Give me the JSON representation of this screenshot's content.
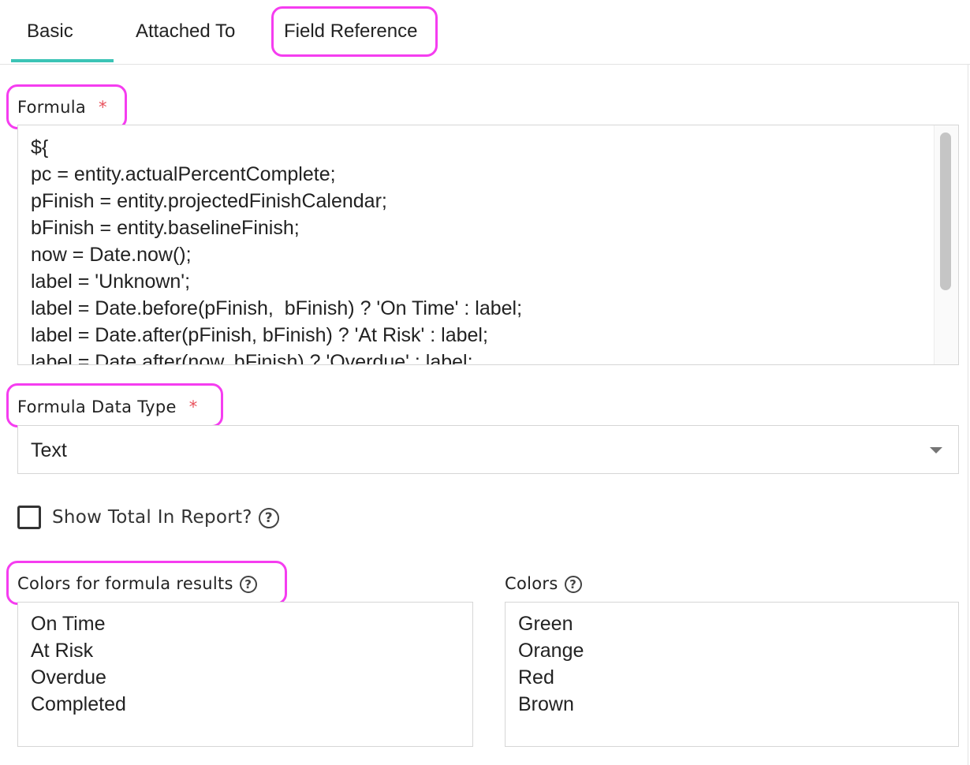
{
  "tabs": [
    {
      "label": "Basic",
      "active": true
    },
    {
      "label": "Attached To",
      "active": false
    },
    {
      "label": "Field Reference",
      "active": false
    }
  ],
  "formula": {
    "label": "Formula",
    "required_mark": "*",
    "lines": [
      "${",
      "pc = entity.actualPercentComplete;",
      "pFinish = entity.projectedFinishCalendar;",
      "bFinish = entity.baselineFinish;",
      "now = Date.now();",
      "label = 'Unknown';",
      "label = Date.before(pFinish,  bFinish) ? 'On Time' : label;",
      "label = Date.after(pFinish, bFinish) ? 'At Risk' : label;",
      "label = Date.after(now, bFinish) ? 'Overdue' : label;"
    ]
  },
  "formula_data_type": {
    "label": "Formula Data Type",
    "required_mark": "*",
    "selected": "Text"
  },
  "show_total": {
    "label": "Show Total In Report?",
    "checked": false,
    "help_icon": "question-circle-icon"
  },
  "colors_results": {
    "label": "Colors for formula results",
    "help_icon": "question-circle-icon",
    "items": [
      "On Time",
      "At Risk",
      "Overdue",
      "Completed"
    ]
  },
  "colors": {
    "label": "Colors",
    "help_icon": "question-circle-icon",
    "items": [
      "Green",
      "Orange",
      "Red",
      "Brown"
    ]
  },
  "theme": {
    "accent": "#3cc4b6",
    "highlight": "#f53df0",
    "required": "#e8505b"
  }
}
